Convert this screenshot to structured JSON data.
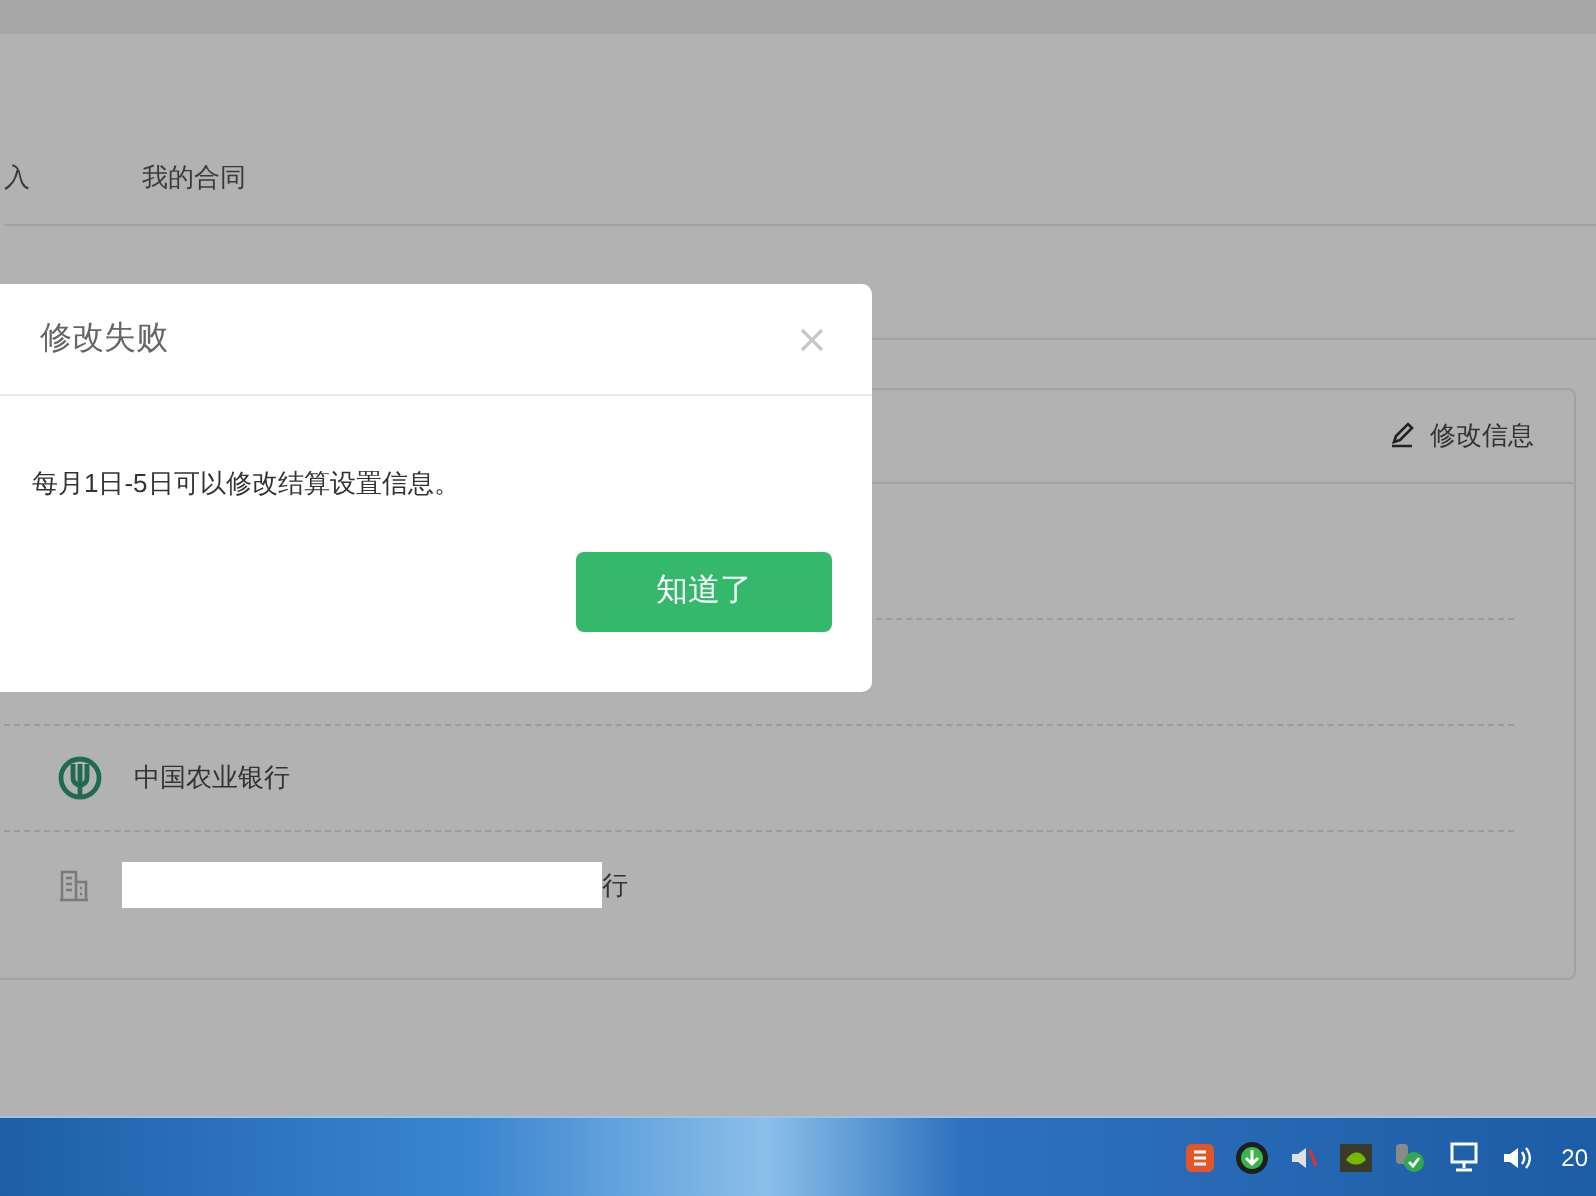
{
  "main_tabs": [
    {
      "label": "入",
      "selected": false
    },
    {
      "label": "我的合同",
      "selected": false
    }
  ],
  "card": {
    "edit_link": "修改信息",
    "rows": [
      {
        "kind": "blank"
      },
      {
        "kind": "blank"
      },
      {
        "kind": "bank",
        "text": "中国农业银行"
      },
      {
        "kind": "branch",
        "text": "行"
      }
    ]
  },
  "dialog": {
    "title": "修改失败",
    "message": "每月1日-5日可以修改结算设置信息。",
    "button": "知道了"
  },
  "taskbar": {
    "clock": "20"
  }
}
